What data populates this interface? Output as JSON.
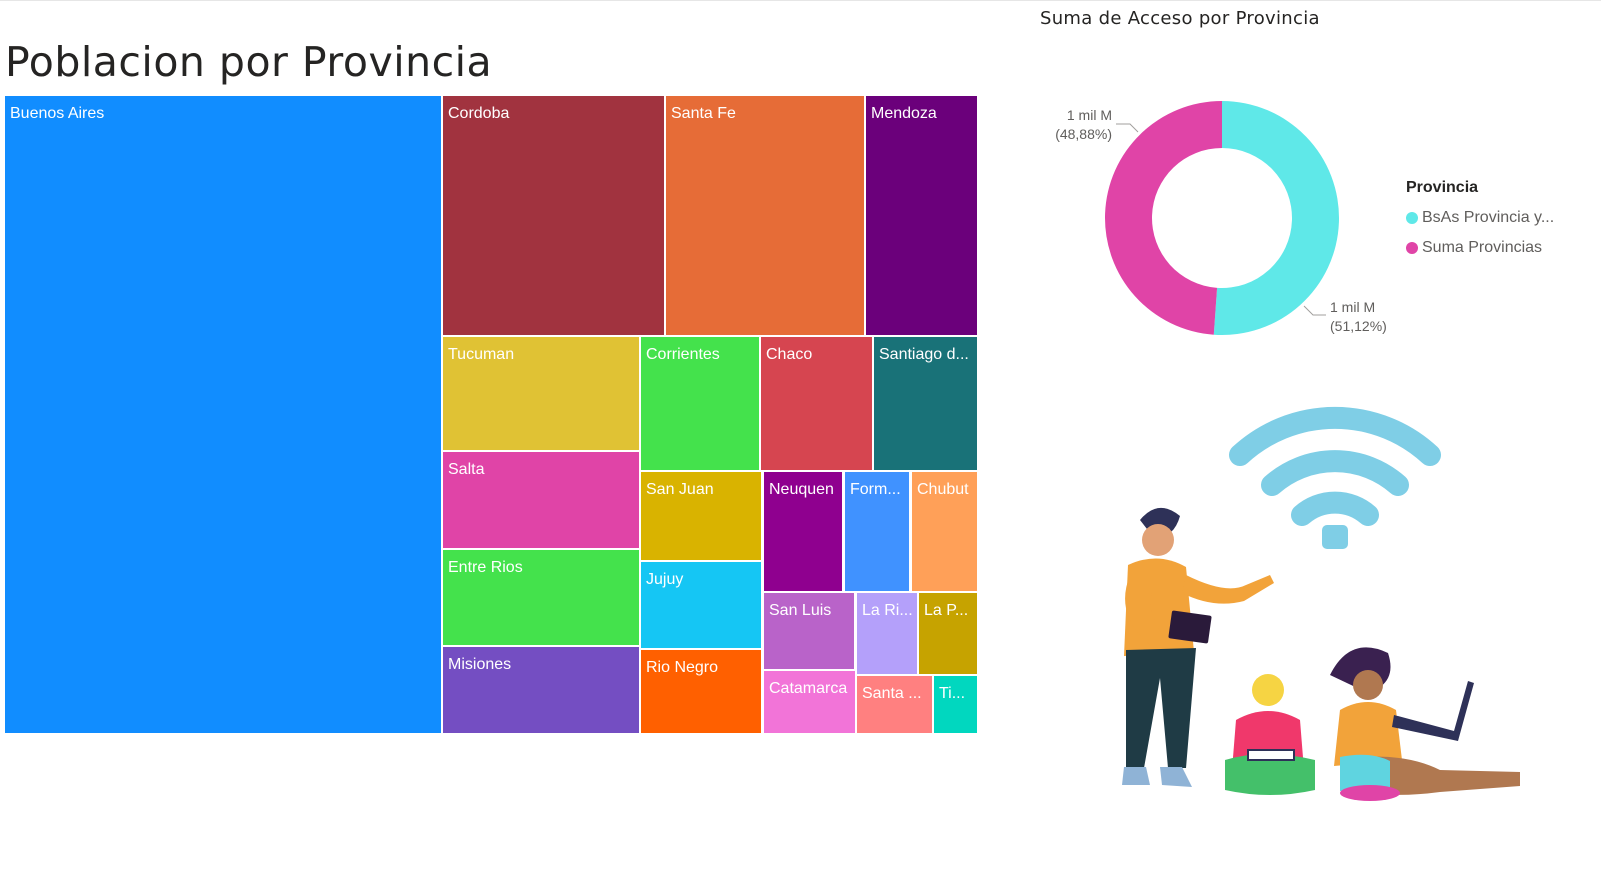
{
  "treemap": {
    "title": "Poblacion por Provincia",
    "tiles": [
      {
        "label": "Buenos Aires",
        "color": "#118DFF"
      },
      {
        "label": "Cordoba",
        "color": "#A1333F"
      },
      {
        "label": "Santa Fe",
        "color": "#E66C37"
      },
      {
        "label": "Mendoza",
        "color": "#6B007B"
      },
      {
        "label": "Tucuman",
        "color": "#E0C234"
      },
      {
        "label": "Corrientes",
        "color": "#44E24C"
      },
      {
        "label": "Chaco",
        "color": "#D64550"
      },
      {
        "label": "Santiago d...",
        "color": "#197278"
      },
      {
        "label": "Salta",
        "color": "#E044A7"
      },
      {
        "label": "San Juan",
        "color": "#D9B300"
      },
      {
        "label": "Neuquen",
        "color": "#8F008F"
      },
      {
        "label": "Form...",
        "color": "#4092FF"
      },
      {
        "label": "Chubut",
        "color": "#FFA058"
      },
      {
        "label": "Entre Rios",
        "color": "#44E24C"
      },
      {
        "label": "Jujuy",
        "color": "#15C6F4"
      },
      {
        "label": "San Luis",
        "color": "#B963C9"
      },
      {
        "label": "La Ri...",
        "color": "#B4A0FA"
      },
      {
        "label": "La P...",
        "color": "#C6A300"
      },
      {
        "label": "Misiones",
        "color": "#744EC2"
      },
      {
        "label": "Rio Negro",
        "color": "#FF6000"
      },
      {
        "label": "Catamarca",
        "color": "#F274D8"
      },
      {
        "label": "Santa ...",
        "color": "#FF8080"
      },
      {
        "label": "Ti...",
        "color": "#01D7BF"
      }
    ]
  },
  "donut": {
    "title": "Suma de Acceso por Provincia",
    "legend_title": "Provincia",
    "slices": [
      {
        "name": "BsAs Provincia y...",
        "value_label": "1 mil M",
        "percent_label": "(51,12%)",
        "percent": 51.12,
        "color": "#5FE8E8"
      },
      {
        "name": "Suma Provincias",
        "value_label": "1 mil M",
        "percent_label": "(48,88%)",
        "percent": 48.88,
        "color": "#E044A7"
      }
    ]
  },
  "chart_data": [
    {
      "type": "treemap",
      "title": "Poblacion por Provincia",
      "categories": [
        "Buenos Aires",
        "Cordoba",
        "Santa Fe",
        "Mendoza",
        "Tucuman",
        "Corrientes",
        "Chaco",
        "Santiago d...",
        "Salta",
        "San Juan",
        "Neuquen",
        "Form...",
        "Chubut",
        "Entre Rios",
        "Jujuy",
        "San Luis",
        "La Ri...",
        "La P...",
        "Misiones",
        "Rio Negro",
        "Catamarca",
        "Santa ...",
        "Ti..."
      ]
    },
    {
      "type": "pie",
      "title": "Suma de Acceso por Provincia",
      "categories": [
        "BsAs Provincia y...",
        "Suma Provincias"
      ],
      "values": [
        51.12,
        48.88
      ],
      "legend": "right"
    }
  ]
}
